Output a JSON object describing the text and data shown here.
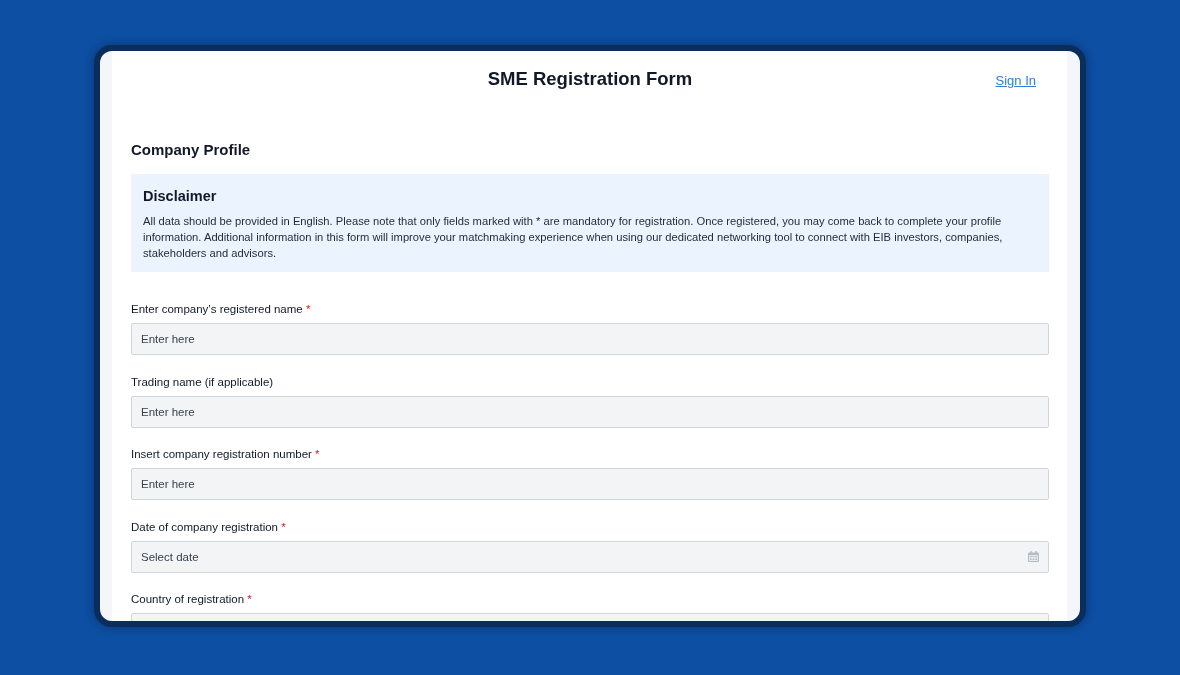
{
  "header": {
    "title": "SME Registration Form",
    "sign_in_link": "Sign In"
  },
  "section": {
    "title": "Company Profile"
  },
  "disclaimer": {
    "title": "Disclaimer",
    "text": "All data should be provided in English. Please note that only fields marked with * are mandatory for registration. Once registered, you may come back to complete your profile information. Additional information in this form will improve your matchmaking experience when using our dedicated networking tool to connect with EIB investors, companies, stakeholders and advisors."
  },
  "fields": [
    {
      "label": "Enter company’s registered name",
      "required_mark": "*",
      "kind": "text",
      "placeholder": "Enter here"
    },
    {
      "label": "Trading name (if applicable)",
      "kind": "text",
      "placeholder": "Enter here"
    },
    {
      "label": "Insert company registration number",
      "required_mark": "*",
      "kind": "text",
      "placeholder": "Enter here"
    },
    {
      "label": "Date of company registration",
      "required_mark": "*",
      "kind": "date",
      "placeholder": "Select date"
    },
    {
      "label": "Country of registration",
      "required_mark": "*",
      "kind": "text"
    }
  ]
}
